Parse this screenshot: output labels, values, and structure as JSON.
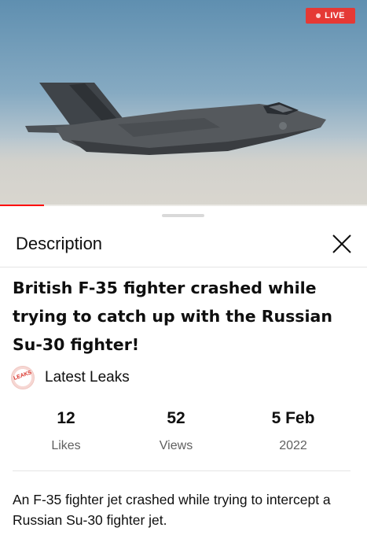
{
  "player": {
    "live_label": "LIVE",
    "progress": 0.12,
    "accent_color": "#ff0000",
    "live_color": "#e53935"
  },
  "sheet": {
    "header_title": "Description",
    "close_icon": "close-icon",
    "video_title": "British F-35 fighter crashed while trying to catch up with the Russian Su-30 fighter!",
    "channel": {
      "avatar_text": "LEAKS",
      "name": "Latest Leaks"
    },
    "stats": [
      {
        "value": "12",
        "label": "Likes"
      },
      {
        "value": "52",
        "label": "Views"
      },
      {
        "value": "5 Feb",
        "label": "2022"
      }
    ],
    "description": "An F-35 fighter jet crashed while trying to intercept a Russian Su-30 fighter jet."
  }
}
